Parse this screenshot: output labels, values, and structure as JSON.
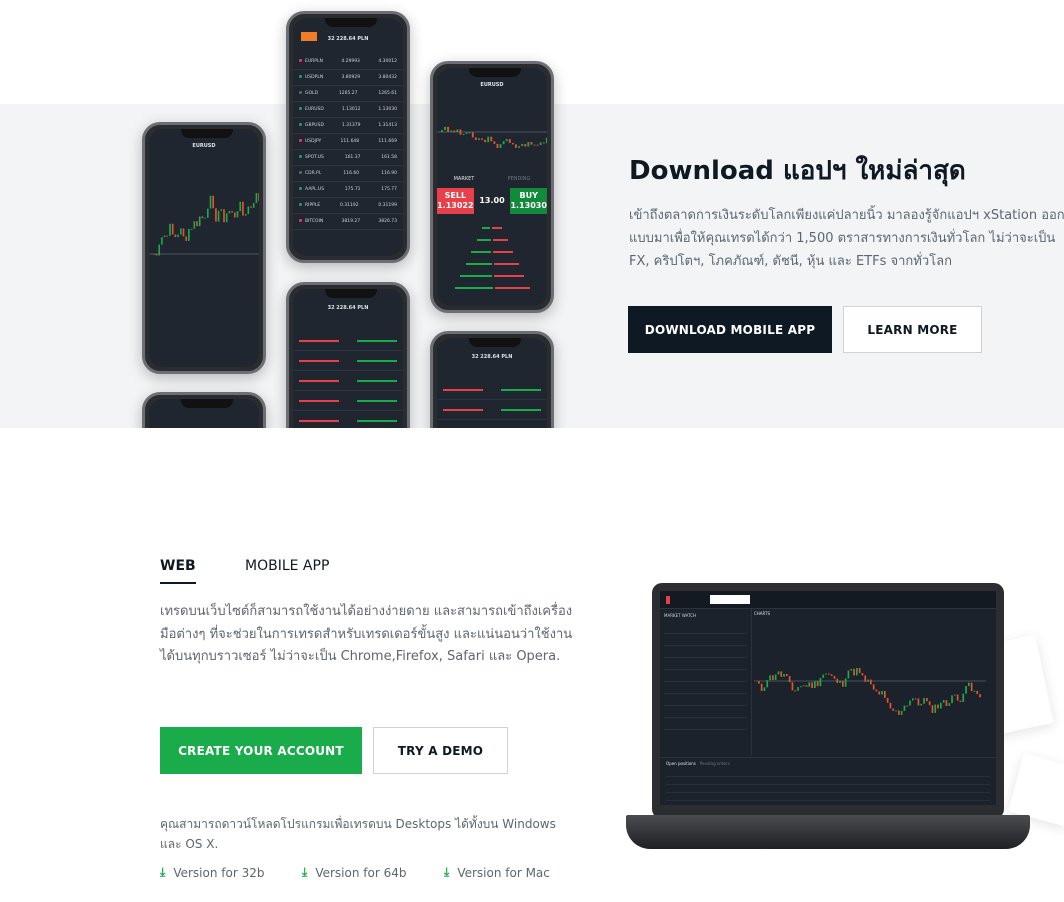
{
  "hero": {
    "title": "Download แอปฯ ใหม่ล่าสุด",
    "description_lines": [
      "เข้าถึงตลาดการเงินระดับโลกเพียงแค่ปลายนิ้ว มาลองรู้จักแอปฯ xStation ออก",
      "แบบมาเพื่อให้คุณเทรดได้กว่า 1,500 ตราสารทางการเงินทั่วโลก ไม่ว่าจะเป็น",
      "FX, คริปโตฯ, โภคภัณฑ์, ดัชนี, หุ้น และ ETFs จากทั่วโลก"
    ],
    "download_button": "DOWNLOAD MOBILE APP",
    "learn_more_button": "LEARN MORE"
  },
  "phones": {
    "account_value": "32 228.64 PLN",
    "instrument": "EURUSD",
    "sell_label": "SELL",
    "buy_label": "BUY",
    "sell_price": "1.13022",
    "buy_price": "1.13030",
    "volume": "13.00",
    "market_tab": "MARKET",
    "pending_tab": "PENDING",
    "watchlist": [
      {
        "symbol": "EURPLN",
        "bid": "4.29993",
        "ask": "4.30012",
        "dir": "down"
      },
      {
        "symbol": "USDPLN",
        "bid": "3.80929",
        "ask": "3.80432",
        "dir": "up"
      },
      {
        "symbol": "GOLD",
        "bid": "1265.27",
        "ask": "1265.61",
        "dir": "flat"
      },
      {
        "symbol": "EURUSD",
        "bid": "1.13012",
        "ask": "1.13030",
        "dir": "up"
      },
      {
        "symbol": "GBPUSD",
        "bid": "1.31379",
        "ask": "1.31413",
        "dir": "up"
      },
      {
        "symbol": "USDJPY",
        "bid": "111.648",
        "ask": "111.669",
        "dir": "down"
      },
      {
        "symbol": "SPOT.US",
        "bid": "161.37",
        "ask": "161.58",
        "dir": "up"
      },
      {
        "symbol": "CDR.PL",
        "bid": "116.60",
        "ask": "116.90",
        "dir": "flat"
      },
      {
        "symbol": "AAPL.US",
        "bid": "175.71",
        "ask": "175.77",
        "dir": "up"
      },
      {
        "symbol": "RIPPLE",
        "bid": "0.31192",
        "ask": "0.31199",
        "dir": "up"
      },
      {
        "symbol": "BITCOIN",
        "bid": "3819.27",
        "ask": "3826.73",
        "dir": "down"
      }
    ]
  },
  "platform": {
    "tabs": [
      {
        "label": "WEB",
        "active": true
      },
      {
        "label": "MOBILE APP",
        "active": false
      }
    ],
    "description": "เทรดบนเว็บไซต์ก็สามารถใช้งานได้อย่างง่ายดาย และสามารถเข้าถึงเครื่องมือต่างๆ ที่จะช่วยในการเทรดสำหรับเทรดเดอร์ขั้นสูง และแน่นอนว่าใช้งานได้บนทุกบราวเซอร์ ไม่ว่าจะเป็น Chrome,Firefox, Safari และ Opera.",
    "create_account_button": "CREATE YOUR ACCOUNT",
    "try_demo_button": "TRY A DEMO",
    "desktop_note": "คุณสามารถดาวน์โหลดโปรแกรมเพื่อเทรดบน Desktops ได้ทั้งบน Windows และ OS X.",
    "downloads": [
      {
        "label": "Version for 32b",
        "icon": "download-icon"
      },
      {
        "label": "Version for 64b",
        "icon": "download-icon"
      },
      {
        "label": "Version for Mac",
        "icon": "download-icon"
      }
    ]
  },
  "laptop": {
    "market_watch": "MARKET WATCH",
    "charts_tab": "CHARTS",
    "open_positions": "Open positions",
    "pending_orders": "Pending orders"
  },
  "colors": {
    "brand_dark": "#0f1923",
    "green": "#1aab4b",
    "red": "#e8404a"
  }
}
